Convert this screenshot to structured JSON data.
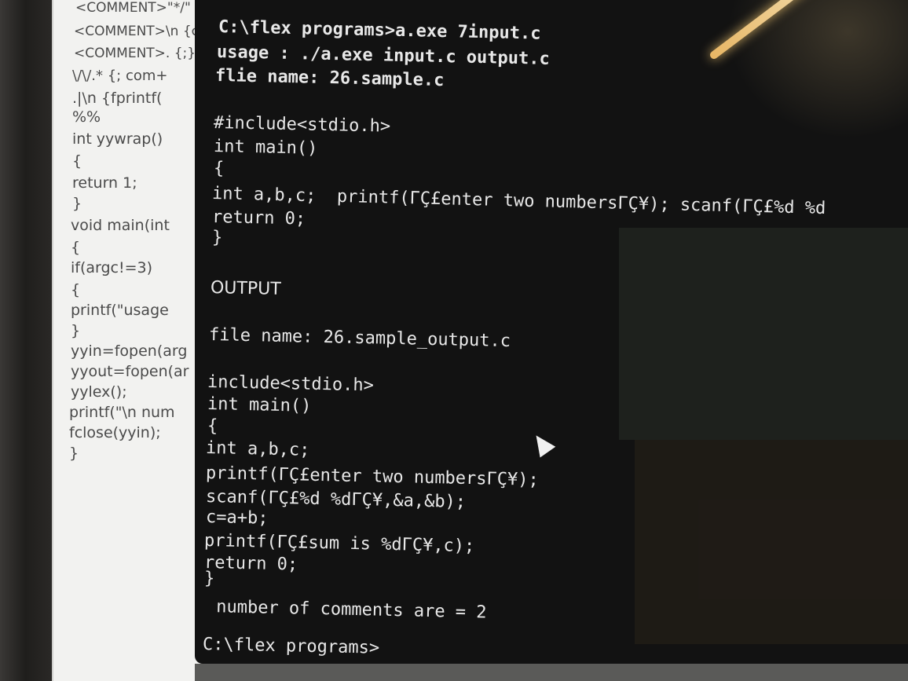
{
  "editor": {
    "lines": [
      "<COMMENT>\"*/\"",
      "<COMMENT>\\n {c",
      "<COMMENT>. {;}",
      "\\/\\/.* {; com+",
      ".|\\n {fprintf(",
      "%%",
      "int yywrap()",
      "{",
      "return 1;",
      "}",
      "void main(int",
      "{",
      "if(argc!=3)",
      "{",
      "printf(\"usage",
      "}",
      "yyin=fopen(arg",
      "yyout=fopen(ar",
      "yylex();",
      "printf(\"\\n num",
      "fclose(yyin);",
      "}"
    ]
  },
  "terminal": {
    "lines": [
      "C:\\flex programs>a.exe 7input.c",
      "usage : ./a.exe input.c output.c",
      "flie name: 26.sample.c",
      "#include<stdio.h>",
      "int main()",
      "{",
      "int a,b,c;  printf(ΓÇ£enter two numbersΓÇ¥); scanf(ΓÇ£%d %d",
      "return 0;",
      "}",
      "OUTPUT",
      "file name: 26.sample_output.c",
      "include<stdio.h>",
      "int main()",
      "{",
      "int a,b,c;",
      "printf(ΓÇ£enter two numbersΓÇ¥);",
      "scanf(ΓÇ£%d %dΓÇ¥,&a,&b);",
      "c=a+b;",
      "printf(ΓÇ£sum is %dΓÇ¥,c);",
      "return 0;",
      "}",
      " number of comments are = 2",
      "C:\\flex programs>"
    ]
  }
}
